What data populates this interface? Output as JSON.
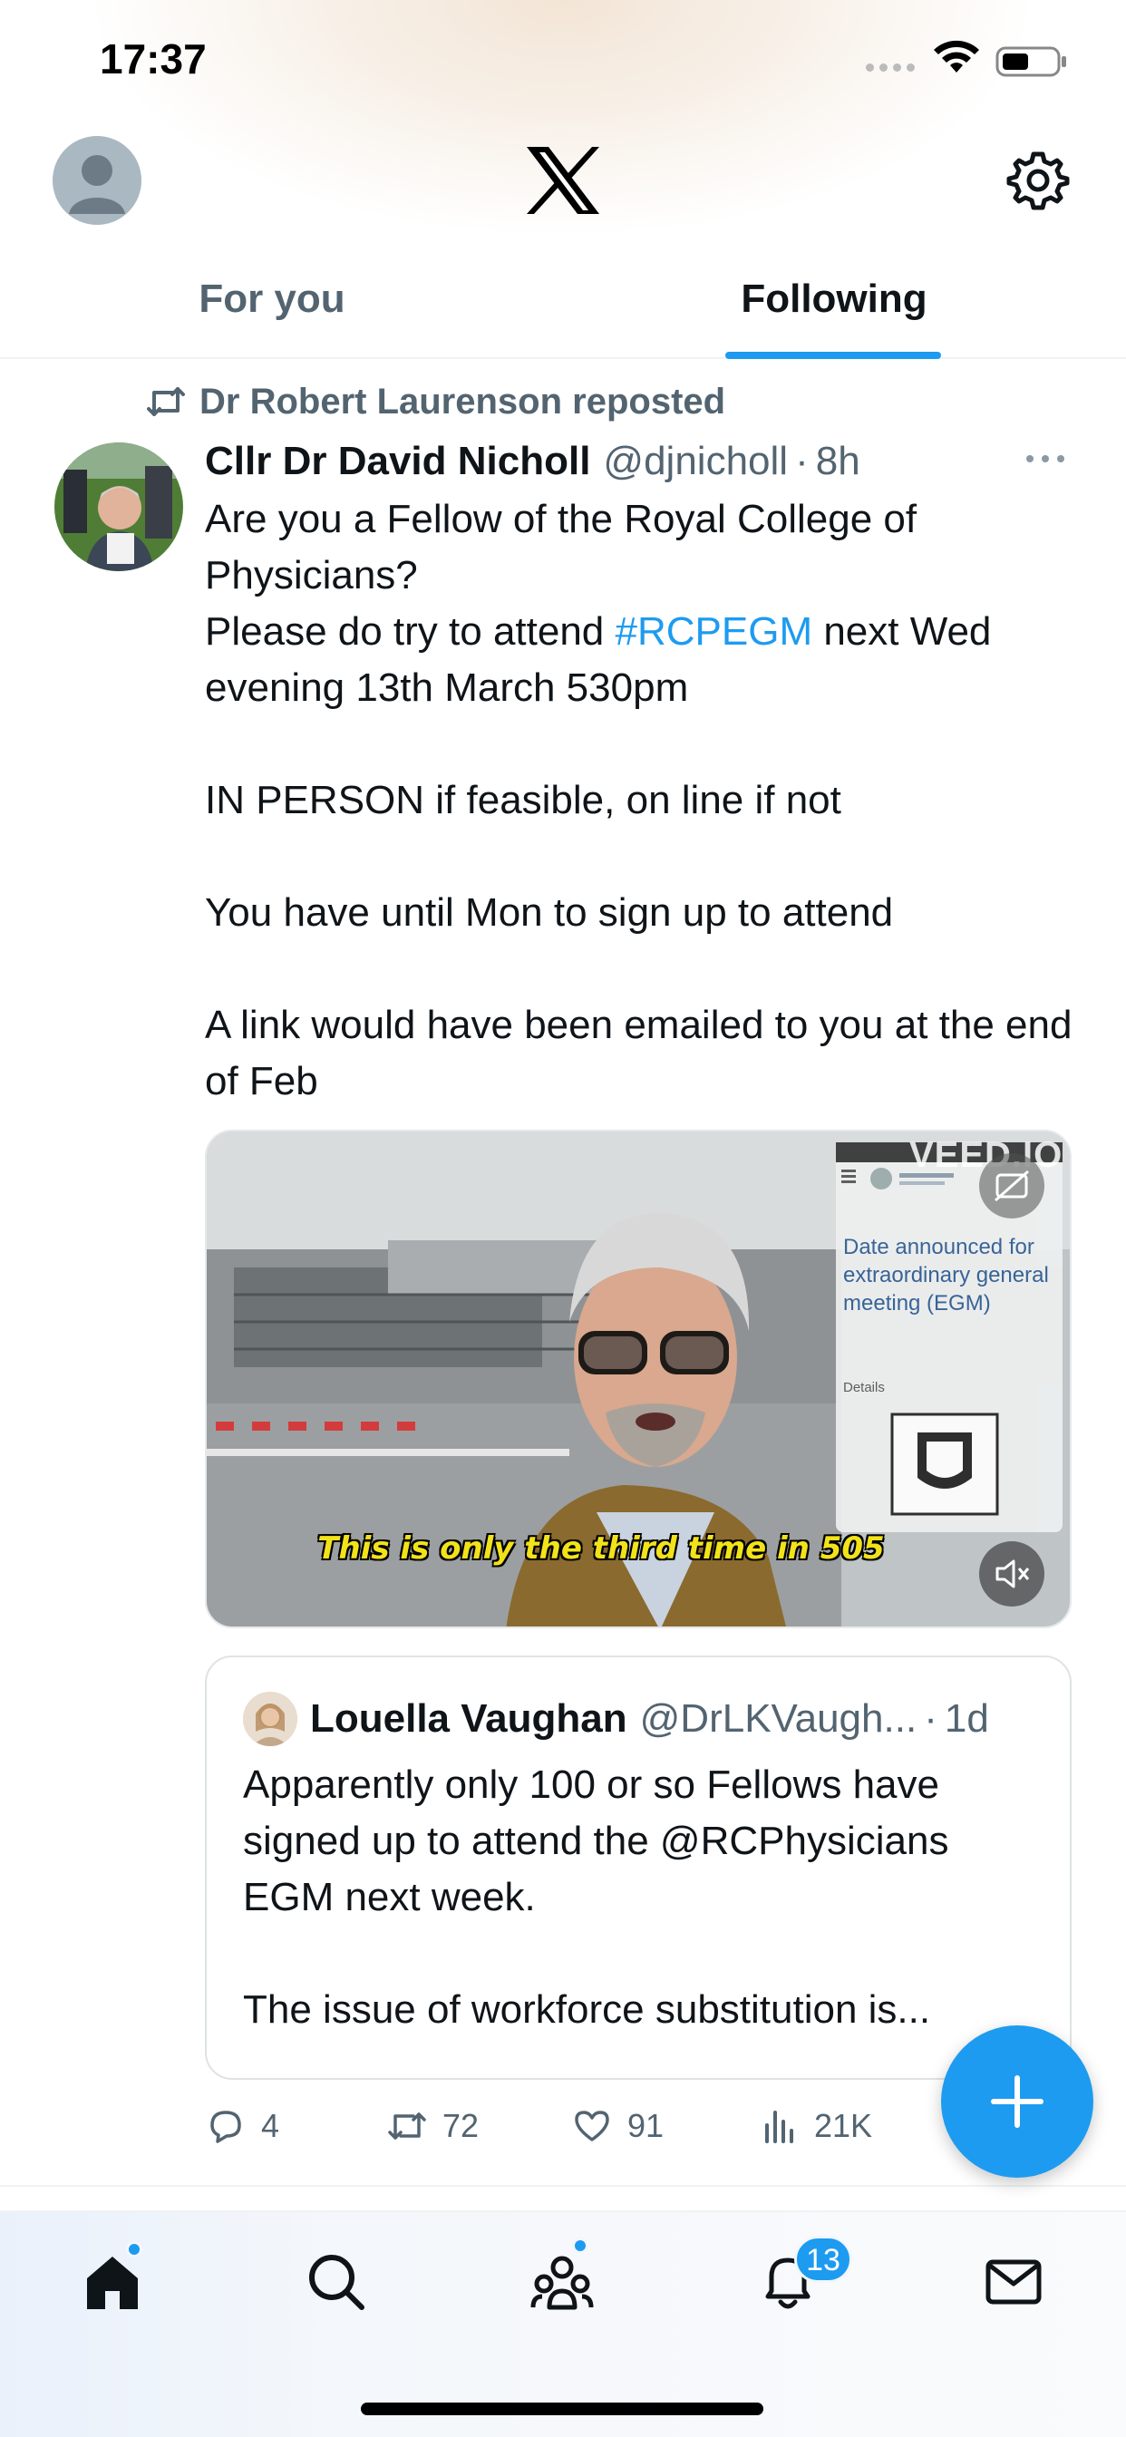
{
  "status_bar": {
    "time": "17:37"
  },
  "header": {
    "logo": "X"
  },
  "tabs": [
    {
      "label": "For you",
      "active": false
    },
    {
      "label": "Following",
      "active": true
    }
  ],
  "tweet": {
    "repost_label": "Dr Robert Laurenson reposted",
    "author_name": "Cllr Dr David Nicholl",
    "author_handle": "@djnicholl",
    "separator": "·",
    "time": "8h",
    "text": {
      "line1": "Are you a Fellow of the Royal College of Physicians?",
      "line2_prefix": "Please do try to attend ",
      "hashtag": "#RCPEGM",
      "line2_suffix": " next Wed evening 13th March 530pm",
      "line3": "IN PERSON if feasible, on line if not",
      "line4": "You have until Mon to sign up to attend",
      "line5": "A link would have been emailed to you at the end of Feb"
    },
    "video": {
      "caption": "This is only the third time in 505",
      "watermark": "VEED.IO",
      "overlay_title": "Date announced for extraordinary general meeting (EGM)",
      "overlay_detail": "Details"
    },
    "quote": {
      "author_name": "Louella Vaughan",
      "author_handle": "@DrLKVaugh...",
      "separator": "·",
      "time": "1d",
      "line1": "Apparently only 100 or so Fellows have",
      "line2": "signed up to attend the @RCPhysicians",
      "line3": "EGM next week.",
      "line4": "The issue of workforce substitution is..."
    },
    "actions": {
      "replies": "4",
      "reposts": "72",
      "likes": "91",
      "views": "21K"
    }
  },
  "nav": {
    "notifications_count": "13"
  },
  "colors": {
    "accent": "#1d9bf0",
    "text_primary": "#0f1419",
    "text_secondary": "#536471"
  }
}
